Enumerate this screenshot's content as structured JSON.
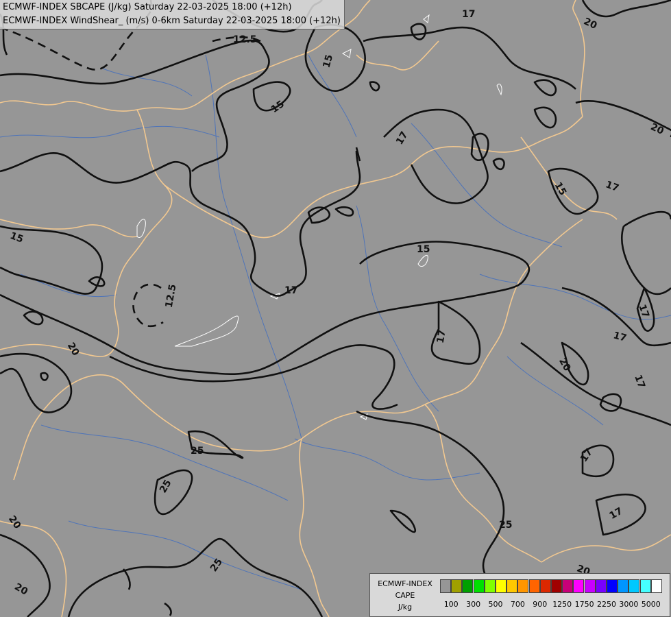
{
  "title": {
    "line1": "ECMWF-INDEX SBCAPE (J/kg) Saturday 22-03-2025 18:00 (+12h)",
    "line2": "ECMWF-INDEX WindShear_ (m/s) 0-6km Saturday 22-03-2025 18:00 (+12h)"
  },
  "contour_labels": [
    "12.5",
    "15",
    "17",
    "20",
    "25"
  ],
  "legend": {
    "line1": "ECMWF-INDEX",
    "line2": "CAPE",
    "line3": "J/kg",
    "colors": [
      "#969696",
      "#a0a000",
      "#00a000",
      "#00e000",
      "#80ff00",
      "#ffff00",
      "#ffc800",
      "#ff9600",
      "#ff6400",
      "#dc2800",
      "#a00000",
      "#c80078",
      "#ff00ff",
      "#c800ff",
      "#7800ff",
      "#0000ff",
      "#0096ff",
      "#00c8ff",
      "#46ffff",
      "#ffffff"
    ],
    "ticks": [
      "100",
      "300",
      "500",
      "700",
      "900",
      "1250",
      "1750",
      "2250",
      "3000",
      "5000"
    ]
  }
}
